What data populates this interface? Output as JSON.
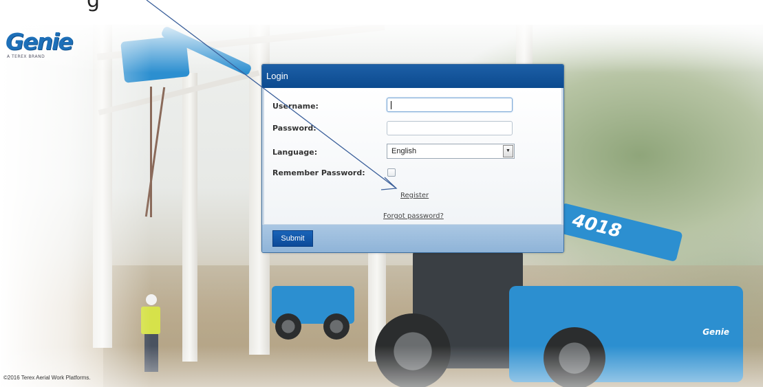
{
  "logo": {
    "wordmark": "Genie",
    "tagline": "A TEREX BRAND"
  },
  "annotation": {
    "cutoff_text": "g"
  },
  "login": {
    "title": "Login",
    "username_label": "Username:",
    "username_value": "",
    "password_label": "Password:",
    "password_value": "",
    "language_label": "Language:",
    "language_selected": "English",
    "remember_label": "Remember Password:",
    "remember_checked": false,
    "register_link": "Register",
    "forgot_link": "Forgot password?",
    "submit_label": "Submit"
  },
  "background": {
    "vehicle_text": "4018",
    "vehicle_brand": "Genie"
  },
  "footer": {
    "copyright": "©2016 Terex Aerial Work Platforms."
  },
  "colors": {
    "brand_blue": "#1d6fb8",
    "header_blue": "#0b4a8f",
    "footer_blue": "#8fb4d8"
  }
}
